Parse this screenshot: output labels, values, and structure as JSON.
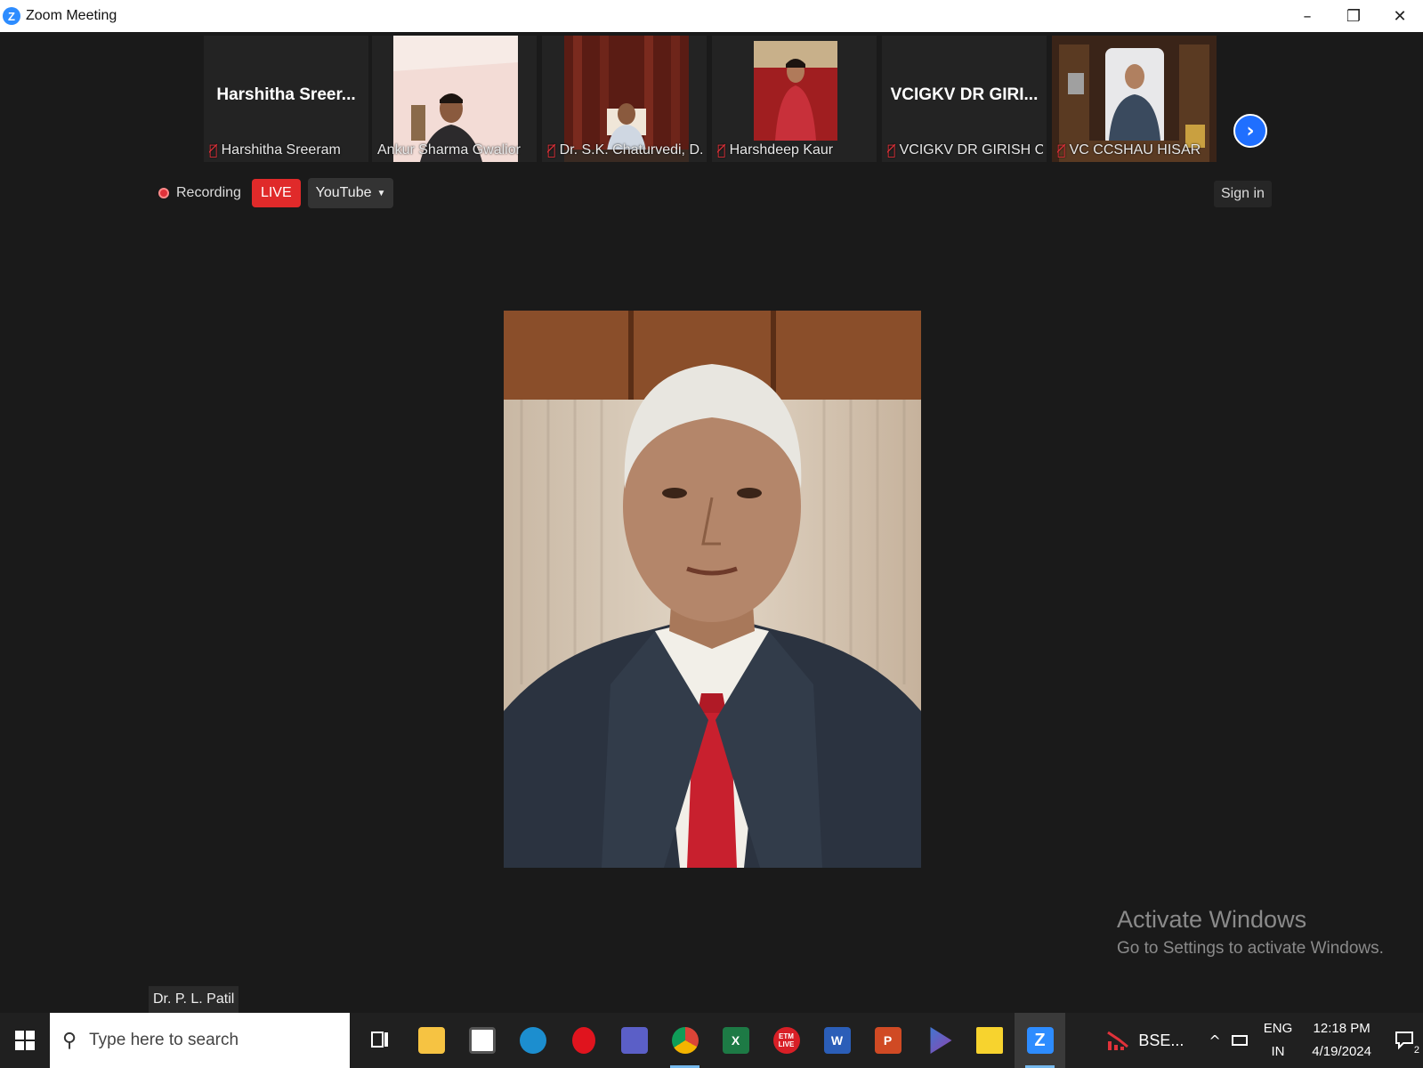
{
  "window": {
    "title": "Zoom Meeting"
  },
  "participants": [
    {
      "display_name": "Harshitha  Sreer...",
      "label": "Harshitha Sreeram",
      "muted": true,
      "has_video": false
    },
    {
      "display_name": "",
      "label": "Ankur Sharma Gwalior",
      "muted": false,
      "has_video": true
    },
    {
      "display_name": "",
      "label": "Dr. S.K. Chaturvedi, D...",
      "muted": true,
      "has_video": true
    },
    {
      "display_name": "",
      "label": "Harshdeep Kaur",
      "muted": true,
      "has_video": true
    },
    {
      "display_name": "VCIGKV DR GIRI...",
      "label": "VCIGKV DR GIRISH C...",
      "muted": true,
      "has_video": false
    },
    {
      "display_name": "",
      "label": "VC CCSHAU HISAR",
      "muted": true,
      "has_video": true
    }
  ],
  "status": {
    "recording_label": "Recording",
    "live_label": "LIVE",
    "stream_target": "YouTube",
    "signin_label": "Sign in"
  },
  "active_speaker": {
    "name": "Dr. P. L. Patil"
  },
  "watermark": {
    "title": "Activate Windows",
    "subtitle": "Go to Settings to activate Windows."
  },
  "taskbar": {
    "search_placeholder": "Type here to search",
    "apps": [
      {
        "name": "task-view-icon",
        "label": ""
      },
      {
        "name": "file-explorer-icon",
        "label": ""
      },
      {
        "name": "microsoft-store-icon",
        "label": ""
      },
      {
        "name": "edge-icon",
        "label": ""
      },
      {
        "name": "opera-icon",
        "label": ""
      },
      {
        "name": "teams-icon",
        "label": ""
      },
      {
        "name": "chrome-icon",
        "label": ""
      },
      {
        "name": "excel-icon",
        "label": "X"
      },
      {
        "name": "etm-live-icon",
        "label": "ETM LIVE"
      },
      {
        "name": "word-icon",
        "label": "W"
      },
      {
        "name": "powerpoint-icon",
        "label": "P"
      },
      {
        "name": "video-player-icon",
        "label": ""
      },
      {
        "name": "sticky-notes-icon",
        "label": ""
      },
      {
        "name": "zoom-icon",
        "label": "Z"
      }
    ],
    "tray": {
      "stock_label": "BSE...",
      "lang_top": "ENG",
      "lang_bottom": "IN",
      "time": "12:18 PM",
      "date": "4/19/2024",
      "notification_count": "2"
    }
  },
  "colors": {
    "zoom_blue": "#2d8cff",
    "live_red": "#e02a2a",
    "muted_red": "#e0323a",
    "background": "#1a1a1a"
  }
}
